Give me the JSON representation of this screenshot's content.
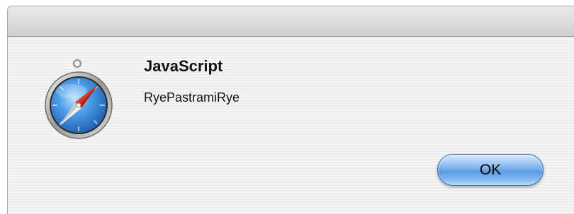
{
  "dialog": {
    "icon": "safari-compass-icon",
    "title": "JavaScript",
    "message": "RyePastramiRye",
    "ok_label": "OK"
  },
  "colors": {
    "button_accent": "#6fa9e9",
    "compass_needle_red": "#e0391f",
    "compass_face_blue": "#3b8be0"
  }
}
